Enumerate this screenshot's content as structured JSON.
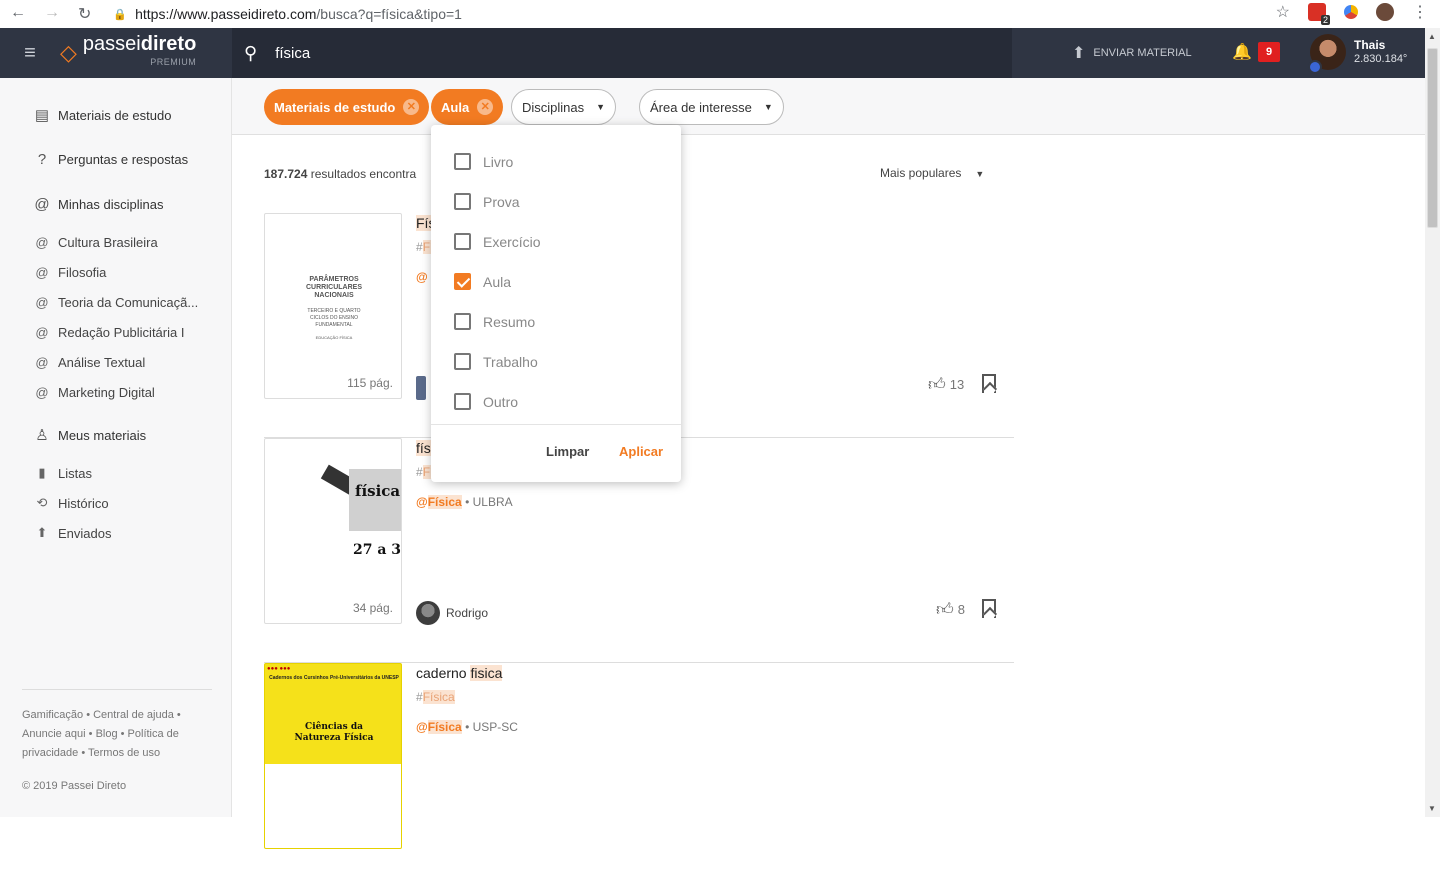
{
  "browser": {
    "url_host": "https://www.passeidireto.com",
    "url_rest": "/busca?q=física&tipo=1",
    "ext_badge": "2"
  },
  "header": {
    "logo_light": "passei",
    "logo_bold": "direto",
    "logo_sub": "PREMIUM",
    "search_query": "física",
    "upload_label": "ENVIAR MATERIAL",
    "notifications": "9",
    "user_name": "Thais",
    "user_points": "2.830.184°"
  },
  "sidebar": {
    "main_items": [
      {
        "label": "Materiais de estudo",
        "icon": "document-icon"
      },
      {
        "label": "Perguntas e respostas",
        "icon": "question-icon"
      },
      {
        "label": "Minhas disciplinas",
        "icon": "at-icon"
      }
    ],
    "disciplines": [
      "Cultura Brasileira",
      "Filosofia",
      "Teoria da Comunicaçã...",
      "Redação Publicitária I",
      "Análise Textual",
      "Marketing Digital"
    ],
    "my_materials": "Meus materiais",
    "material_items": [
      "Listas",
      "Histórico",
      "Enviados"
    ],
    "footer": "Gamificação • Central de ajuda • Anuncie aqui • Blog • Política de privacidade • Termos de uso",
    "copyright": "© 2019 Passei Direto"
  },
  "filters": {
    "active": [
      "Materiais de estudo",
      "Aula"
    ],
    "dropdowns": [
      "Disciplinas",
      "Área de interesse"
    ]
  },
  "results": {
    "count": "187.724",
    "count_suffix": " resultados encontra",
    "sort_label": "Mais populares",
    "cards": [
      {
        "title_visible": "Fís",
        "tag_prefix": "#",
        "tag_visible": "Fí",
        "discipline_at": "@",
        "pages": "115 pág.",
        "likes": "13",
        "doc_title": "PARÂMETROS CURRICULARES NACIONAIS",
        "doc_sub": "TERCEIRO E QUARTO CICLOS DO ENSINO FUNDAMENTAL",
        "doc_area": "EDUCAÇÃO FÍSICA"
      },
      {
        "title_visible": "fís",
        "tag_prefix": "#",
        "tag_visible": "Fí",
        "discipline_at": "@",
        "discipline": "Física",
        "institution": " • ULBRA",
        "author": "Rodrigo",
        "pages": "34 pág.",
        "likes": "8",
        "doc_title": "física",
        "doc_num": "27 a 3"
      },
      {
        "title_plain": "caderno ",
        "title_hl": "fisica",
        "tag_prefix": "#",
        "tag_hl": "Física",
        "discipline_at": "@",
        "discipline": "Física",
        "institution": " • USP-SC",
        "doc_header": "Cadernos dos Cursinhos Pré-Universitários da UNESP",
        "doc_title": "Ciências da Natureza Física"
      }
    ]
  },
  "type_dropdown": {
    "options": [
      {
        "label": "Livro",
        "checked": false
      },
      {
        "label": "Prova",
        "checked": false
      },
      {
        "label": "Exercício",
        "checked": false
      },
      {
        "label": "Aula",
        "checked": true
      },
      {
        "label": "Resumo",
        "checked": false
      },
      {
        "label": "Trabalho",
        "checked": false
      },
      {
        "label": "Outro",
        "checked": false
      }
    ],
    "clear_label": "Limpar",
    "apply_label": "Aplicar"
  },
  "colors": {
    "brand_orange": "#f27b22",
    "topbar": "#2f3543",
    "highlight": "#fbe3d1"
  }
}
